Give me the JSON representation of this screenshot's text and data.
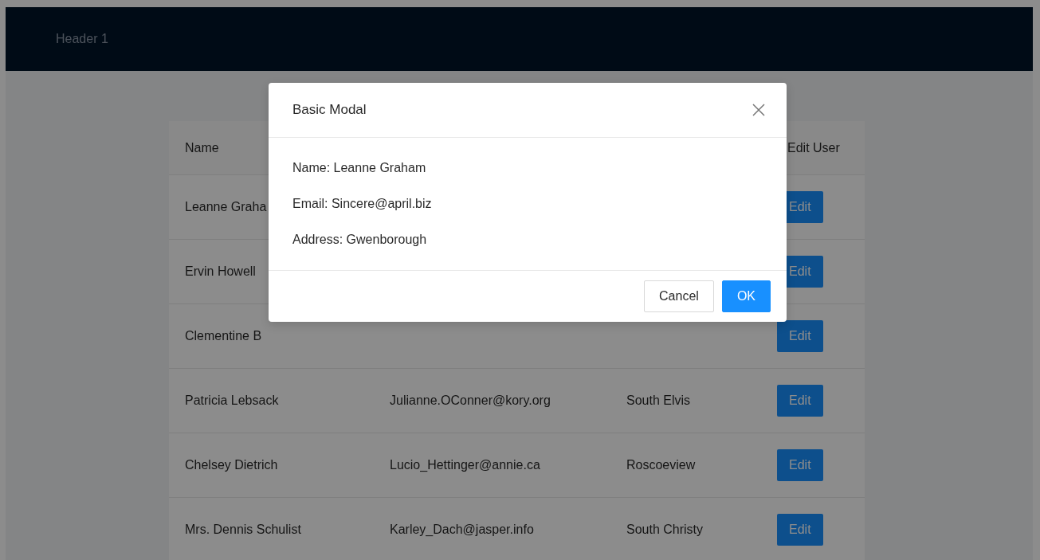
{
  "header": {
    "title": "Header 1"
  },
  "table": {
    "columns": [
      {
        "label": "Name"
      },
      {
        "label": "Edit User"
      }
    ],
    "rows": [
      {
        "name": "Leanne Graha",
        "button": "Edit"
      },
      {
        "name": "Ervin Howell",
        "button": "Edit"
      },
      {
        "name": "Clementine B",
        "button": "Edit"
      },
      {
        "name": "Patricia Lebsack",
        "email": "Julianne.OConner@kory.org",
        "address": "South Elvis",
        "button": "Edit"
      },
      {
        "name": "Chelsey Dietrich",
        "email": "Lucio_Hettinger@annie.ca",
        "address": "Roscoeview",
        "button": "Edit"
      },
      {
        "name": "Mrs. Dennis Schulist",
        "email": "Karley_Dach@jasper.info",
        "address": "South Christy",
        "button": "Edit"
      }
    ]
  },
  "modal": {
    "title": "Basic Modal",
    "lines": [
      "Name: Leanne Graham",
      "Email: Sincere@april.biz",
      "Address: Gwenborough"
    ],
    "buttons": [
      {
        "label": "Cancel",
        "kind": "default"
      },
      {
        "label": "OK",
        "kind": "primary"
      }
    ]
  }
}
